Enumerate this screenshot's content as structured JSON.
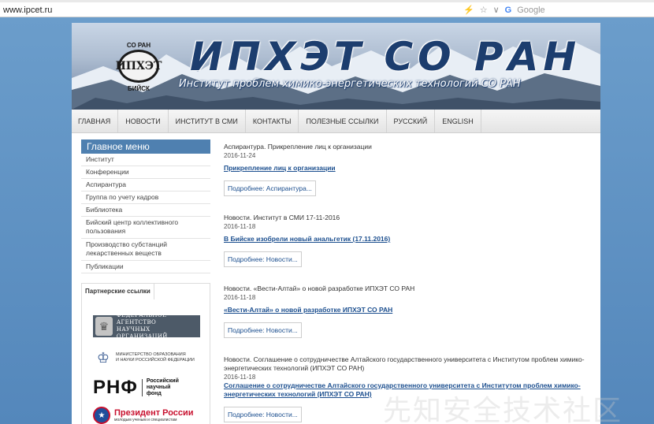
{
  "browser": {
    "url": "www.ipcet.ru",
    "search_engine_letter": "G",
    "search_placeholder": "Google",
    "icons": [
      "bolt-icon",
      "star-icon",
      "chevron-down-icon"
    ]
  },
  "colors": {
    "page_bg": "#5b8fc0",
    "menu_head": "#4f80b0",
    "link": "#1c4f8f",
    "title": "#1c3d6e"
  },
  "header": {
    "title": "ИПХЭТ СО РАН",
    "subtitle": "Институт проблем химико-энергетических технологий СО РАН",
    "logo_top": "СО РАН",
    "logo_mid": "ИПХЭТ",
    "logo_bot": "БИЙСК"
  },
  "nav": {
    "items": [
      {
        "label": "ГЛАВНАЯ"
      },
      {
        "label": "НОВОСТИ"
      },
      {
        "label": "ИНСТИТУТ В СМИ"
      },
      {
        "label": "КОНТАКТЫ"
      },
      {
        "label": "ПОЛЕЗНЫЕ ССЫЛКИ"
      },
      {
        "label": "РУССКИЙ"
      },
      {
        "label": "ENGLISH"
      }
    ]
  },
  "sidebar": {
    "menu_title": "Главное меню",
    "items": [
      {
        "label": "Институт"
      },
      {
        "label": "Конференции"
      },
      {
        "label": "Аспирантура"
      },
      {
        "label": "Группа по учету кадров"
      },
      {
        "label": "Библиотека"
      },
      {
        "label": "Бийский центр коллективного пользования"
      },
      {
        "label": "Производство субстанций лекарственных веществ"
      },
      {
        "label": "Публикации"
      }
    ],
    "partners_tab": "Партнерские ссылки",
    "partners": {
      "fano_line1": "ФЕДЕРАЛЬНОЕ АГЕНТСТВО",
      "fano_line2": "НАУЧНЫХ ОРГАНИЗАЦИЙ",
      "minobr_line1": "МИНИСТЕРСТВО ОБРАЗОВАНИЯ",
      "minobr_line2": "И НАУКИ РОССИЙСКОЙ ФЕДЕРАЦИИ",
      "rnf_abbr": "РНФ",
      "rnf_line1": "Российский",
      "rnf_line2": "научный",
      "rnf_line3": "фонд",
      "prez_title": "Президент России",
      "prez_sub": "молодым ученым и специалистам"
    }
  },
  "news": [
    {
      "category": "Аспирантура. Прикрепление лиц к организации",
      "date": "2016-11-24",
      "title": "Прикрепление лиц к организации",
      "more": "Подробнее: Аспирантура..."
    },
    {
      "category": "Новости. Институт в СМИ 17-11-2016",
      "date": "2016-11-18",
      "title": "В Бийске изобрели новый анальгетик (17.11.2016)",
      "more": "Подробнее: Новости..."
    },
    {
      "category": "Новости. «Вести-Алтай» о новой разработке ИПХЭТ СО РАН",
      "date": "2016-11-18",
      "title": "«Вести-Алтай» о новой разработке ИПХЭТ СО РАН",
      "more": "Подробнее: Новости..."
    },
    {
      "category": "Новости. Соглашение о сотрудничестве Алтайского государственного университета с Институтом проблем химико-энергетических технологий (ИПХЭТ СО РАН)",
      "date": "2016-11-18",
      "title": "Соглашение о сотрудничестве Алтайского государственного университета с Институтом проблем химико-энергетических технологий (ИПХЭТ СО РАН)",
      "more": "Подробнее: Новости..."
    }
  ],
  "watermark": "先知安全技术社区"
}
